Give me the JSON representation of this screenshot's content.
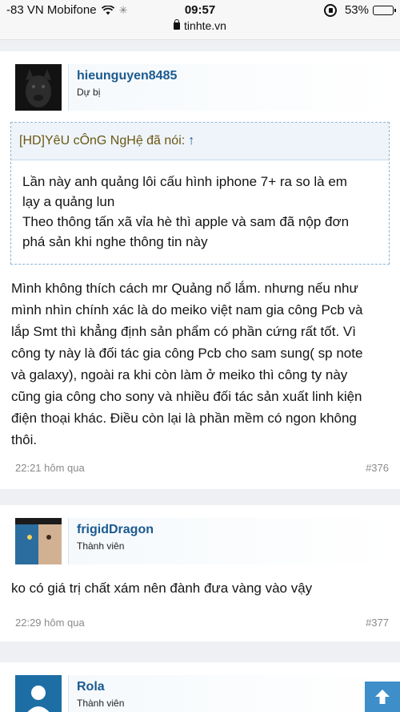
{
  "status": {
    "carrier": "-83 VN Mobifone",
    "time": "09:57",
    "battery": "53%",
    "battery_level": 0.53,
    "url": "tinhte.vn"
  },
  "posts": [
    {
      "username": "hieunguyen8485",
      "user_title": "Dự bị",
      "quote": {
        "author": "[HD]YêU cÔnG NgHệ đã nói:",
        "arrow": "↑",
        "lines": [
          "Lần này anh quảng lôi cấu hình iphone 7+ ra so là em",
          "lạy a quảng lun",
          "Theo thông tấn xã vỉa hè thì apple và sam đã nộp đơn",
          "phá sản khi nghe thông tin này"
        ]
      },
      "message_lines": [
        "Mình không thích cách mr Quảng nổ lắm. nhưng nếu như",
        "mình nhìn chính xác là do meiko việt nam gia công Pcb và",
        "lắp Smt thì khẳng định sản phẩm có phần cứng rất tốt. Vì",
        "công ty này là đối tác gia công Pcb cho sam sung( sp note",
        "và galaxy), ngoài ra khi còn làm ở meiko thì công ty này",
        "cũng gia công cho sony và nhiều đối tác sản xuất linh kiện",
        "điện thoại khác. Điều còn lại là phần mềm có ngon không",
        "thôi."
      ],
      "time": "22:21 hôm qua",
      "number": "#376"
    },
    {
      "username": "frigidDragon",
      "user_title": "Thành viên",
      "message": "ko có giá trị chất xám nên đành đưa vàng vào vậy",
      "time": "22:29 hôm qua",
      "number": "#377"
    },
    {
      "username": "Rola",
      "user_title": "Thành viên"
    }
  ],
  "icons": {
    "wifi": "wifi-icon",
    "loading": "loading-icon",
    "rotation_lock": "rotation-lock-icon",
    "battery": "battery-icon",
    "secure": "lock-icon",
    "scroll_top": "arrow-up-icon"
  },
  "colors": {
    "username": "#1b5a8f",
    "quote_border": "#8db3d4",
    "scroll_top_bg": "#3d8ec9"
  }
}
